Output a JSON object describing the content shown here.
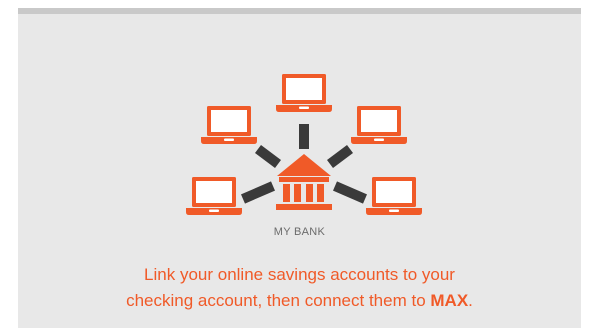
{
  "colors": {
    "accent": "#f05a28",
    "connector": "#3a3a3a",
    "panel": "#e8e8e8",
    "panel_top_rule": "#c9c9c9",
    "label": "#6b6b6b"
  },
  "illustration": {
    "center_icon": "bank-building-icon",
    "node_icon": "laptop-icon",
    "node_count": 5,
    "center_label": "MY BANK"
  },
  "caption": {
    "line1": "Link your online savings accounts to your",
    "line2_prefix": "checking account, then connect them to ",
    "brand": "MAX",
    "line2_suffix": "."
  }
}
